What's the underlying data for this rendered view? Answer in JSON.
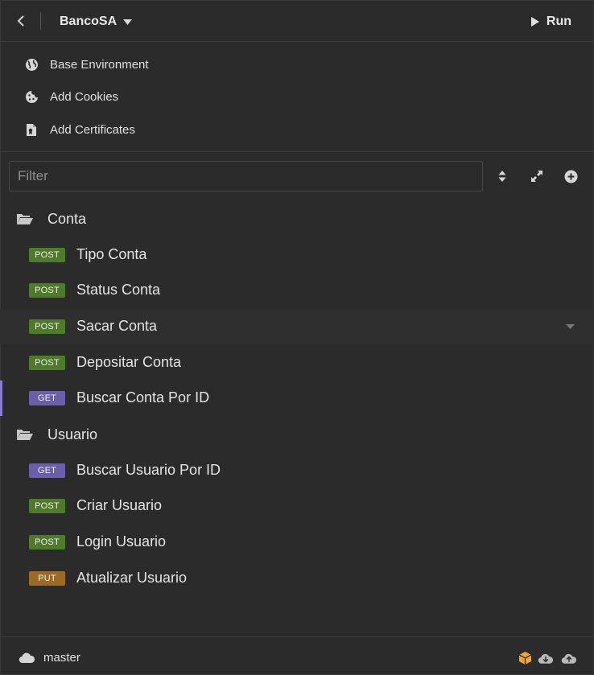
{
  "header": {
    "project_name": "BancoSA",
    "run_label": "Run"
  },
  "environments": [
    {
      "label": "Base Environment",
      "icon": "globe-icon"
    },
    {
      "label": "Add Cookies",
      "icon": "cookie-icon"
    },
    {
      "label": "Add Certificates",
      "icon": "certificate-icon"
    }
  ],
  "filter": {
    "placeholder": "Filter",
    "value": ""
  },
  "colors": {
    "post": "#4f7a2a",
    "get": "#6a5fa8",
    "put": "#9c6a22",
    "active_bar": "#8b7bd1",
    "sync_accent": "#f5a623"
  },
  "folders": [
    {
      "name": "Conta",
      "requests": [
        {
          "method": "POST",
          "name": "Tipo Conta"
        },
        {
          "method": "POST",
          "name": "Status Conta"
        },
        {
          "method": "POST",
          "name": "Sacar Conta"
        },
        {
          "method": "POST",
          "name": "Depositar Conta"
        },
        {
          "method": "GET",
          "name": "Buscar Conta Por ID"
        }
      ]
    },
    {
      "name": "Usuario",
      "requests": [
        {
          "method": "GET",
          "name": "Buscar Usuario Por ID"
        },
        {
          "method": "POST",
          "name": "Criar Usuario"
        },
        {
          "method": "POST",
          "name": "Login Usuario"
        },
        {
          "method": "PUT",
          "name": "Atualizar Usuario"
        }
      ]
    }
  ],
  "footer": {
    "branch": "master"
  }
}
